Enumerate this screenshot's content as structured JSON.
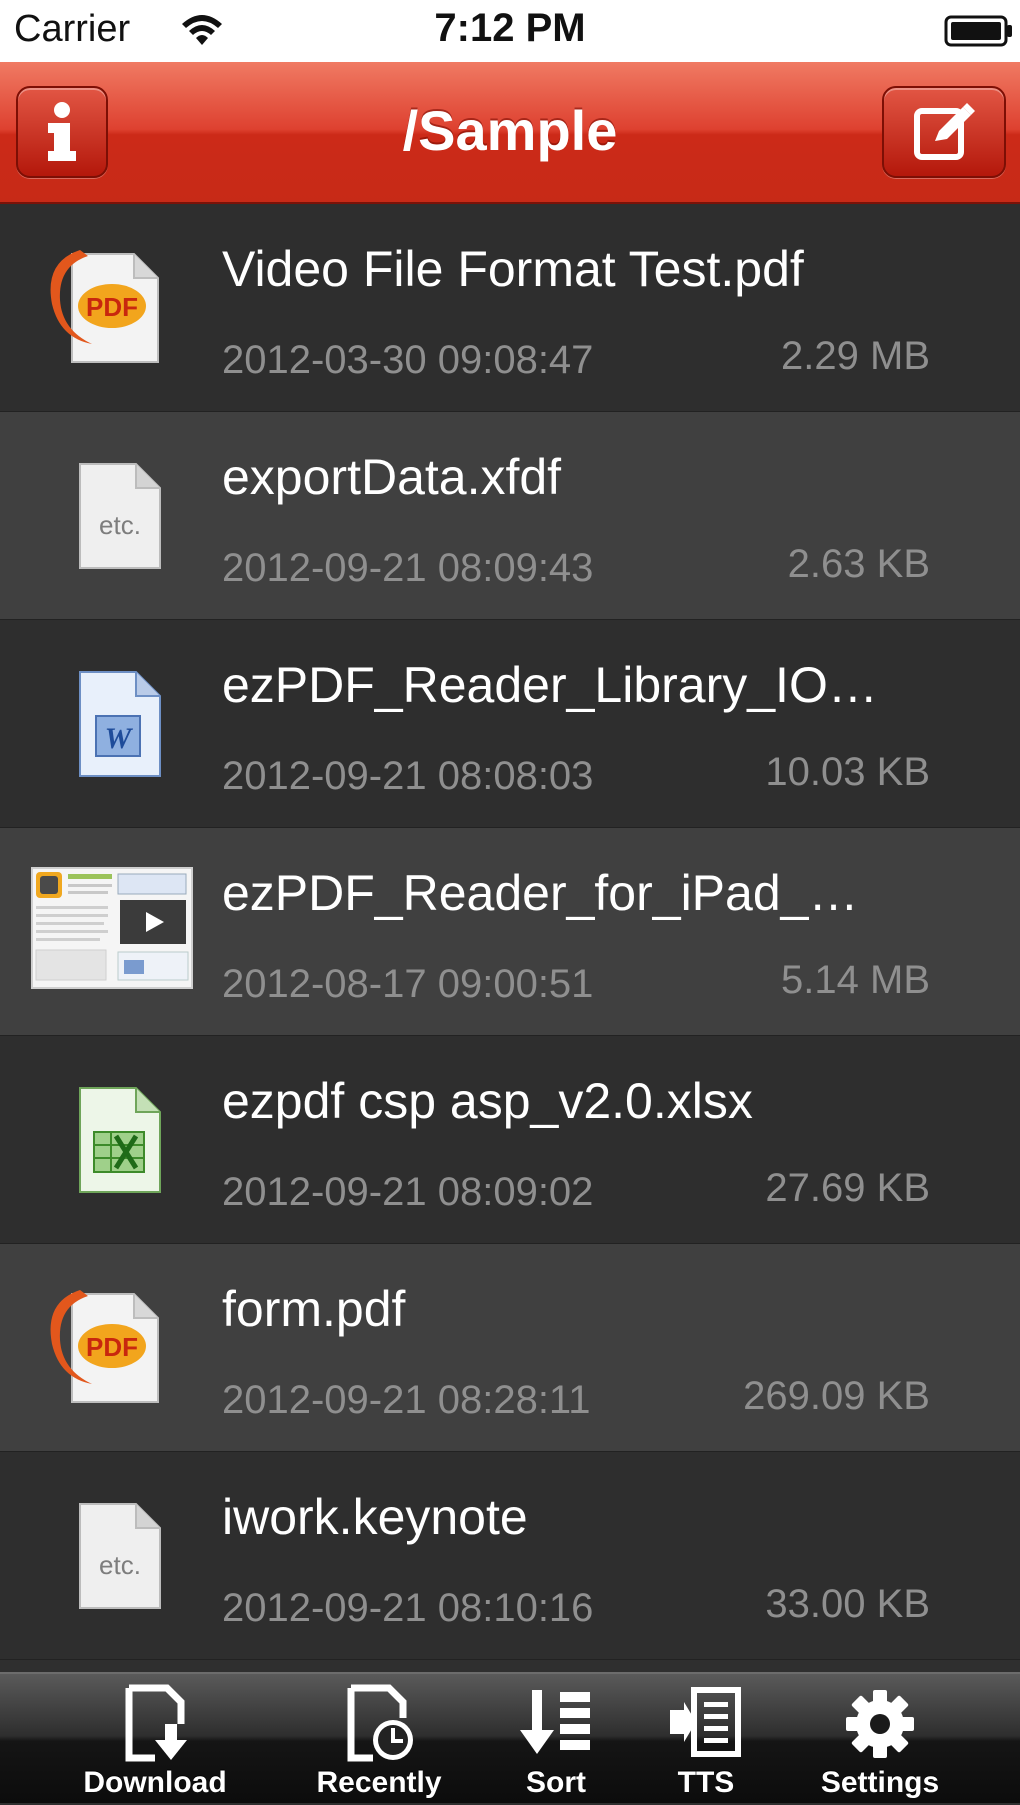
{
  "status_bar": {
    "carrier": "Carrier",
    "time": "7:12 PM"
  },
  "nav": {
    "title": "/Sample",
    "info_icon": "info-icon",
    "edit_icon": "compose-icon"
  },
  "files": [
    {
      "name": "Video File Format Test.pdf",
      "date": "2012-03-30 09:08:47",
      "size": "2.29 MB",
      "type": "pdf"
    },
    {
      "name": "exportData.xfdf",
      "date": "2012-09-21 08:09:43",
      "size": "2.63 KB",
      "type": "etc",
      "icon_text": "etc."
    },
    {
      "name": "ezPDF_Reader_Library_IO…",
      "date": "2012-09-21 08:08:03",
      "size": "10.03 KB",
      "type": "word",
      "icon_text": "W"
    },
    {
      "name": "ezPDF_Reader_for_iPad_…",
      "date": "2012-08-17 09:00:51",
      "size": "5.14 MB",
      "type": "thumbnail"
    },
    {
      "name": "ezpdf csp asp_v2.0.xlsx",
      "date": "2012-09-21 08:09:02",
      "size": "27.69 KB",
      "type": "excel"
    },
    {
      "name": "form.pdf",
      "date": "2012-09-21 08:28:11",
      "size": "269.09 KB",
      "type": "pdf"
    },
    {
      "name": "iwork.keynote",
      "date": "2012-09-21 08:10:16",
      "size": "33.00 KB",
      "type": "etc",
      "icon_text": "etc."
    }
  ],
  "pdf_icon_text": "PDF",
  "toolbar": [
    {
      "label": "Download",
      "icon": "download-icon"
    },
    {
      "label": "Recently",
      "icon": "recent-clock-icon"
    },
    {
      "label": "Sort",
      "icon": "sort-icon"
    },
    {
      "label": "TTS",
      "icon": "tts-icon"
    },
    {
      "label": "Settings",
      "icon": "gear-icon"
    }
  ],
  "colors": {
    "nav_red": "#d93a28",
    "list_dark": "#2e2e2e",
    "list_light": "#404040",
    "meta_gray": "#8f8f8f"
  }
}
